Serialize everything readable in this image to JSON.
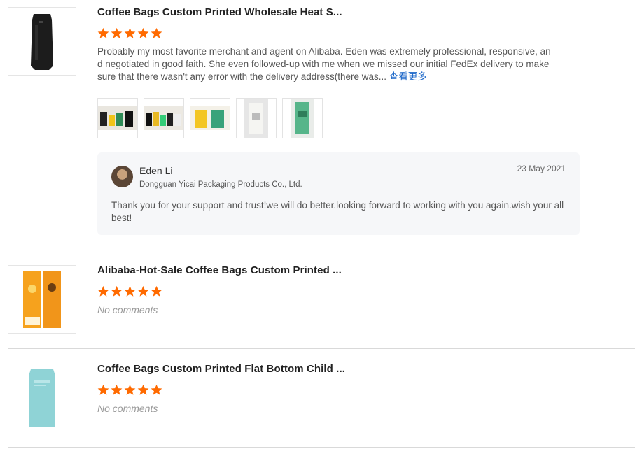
{
  "colors": {
    "star": "#ff6a00",
    "link": "#1a66c8",
    "divider": "#d9d9d9",
    "reply_bg": "#f6f7f9"
  },
  "reviews": [
    {
      "product_title": "Coffee Bags Custom Printed Wholesale Heat S...",
      "rating": 5,
      "comment": "Probably my most favorite merchant and agent on Alibaba.  Eden was extremely professional, responsive, and negotiated in good faith. She even followed-up with me when we missed our initial FedEx delivery to make sure that there wasn't any error with the delivery address(there was...",
      "see_more": "查看更多",
      "photos": [
        "review-photo-1",
        "review-photo-2",
        "review-photo-3",
        "review-photo-4",
        "review-photo-5"
      ],
      "reply": {
        "name": "Eden Li",
        "company": "Dongguan Yicai Packaging Products Co., Ltd.",
        "date": "23 May 2021",
        "text": "Thank you for your support and trust!we will do better.looking forward to working with you again.wish your all best!"
      }
    },
    {
      "product_title": "Alibaba-Hot-Sale Coffee Bags Custom Printed ...",
      "rating": 5,
      "comment": "No comments"
    },
    {
      "product_title": "Coffee Bags Custom Printed Flat Bottom Child ...",
      "rating": 5,
      "comment": "No comments"
    }
  ]
}
